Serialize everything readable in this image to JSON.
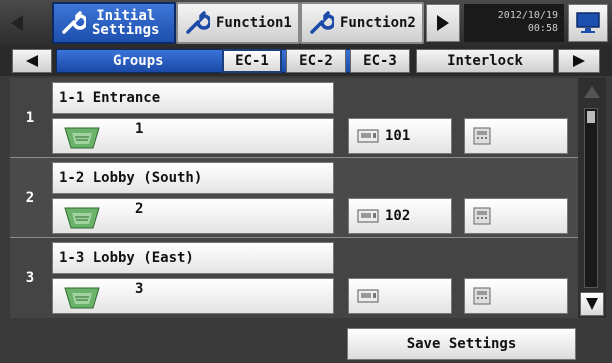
{
  "header": {
    "tabs": [
      {
        "label_line1": "Initial",
        "label_line2": "Settings",
        "active": true
      },
      {
        "label": "Function1",
        "active": false
      },
      {
        "label": "Function2",
        "active": false
      }
    ],
    "date": "2012/10/19",
    "time": "00:58",
    "icons": {
      "prev": "left-arrow-icon",
      "next": "right-arrow-icon",
      "tool": "wrench-icon",
      "monitor": "monitor-icon"
    }
  },
  "subtabs": {
    "groups_label": "Groups",
    "ec_tabs": [
      "EC-1",
      "EC-2",
      "EC-3"
    ],
    "interlock_label": "Interlock"
  },
  "rows": [
    {
      "index": "1",
      "name": "1-1 Entrance",
      "unit": "1",
      "controller": "101"
    },
    {
      "index": "2",
      "name": "1-2 Lobby (South)",
      "unit": "2",
      "controller": "102"
    },
    {
      "index": "3",
      "name": "1-3 Lobby (East)",
      "unit": "3",
      "controller": ""
    }
  ],
  "footer": {
    "save_label": "Save Settings"
  },
  "colors": {
    "accent": "#1d4fae",
    "background": "#3a3a3a"
  }
}
